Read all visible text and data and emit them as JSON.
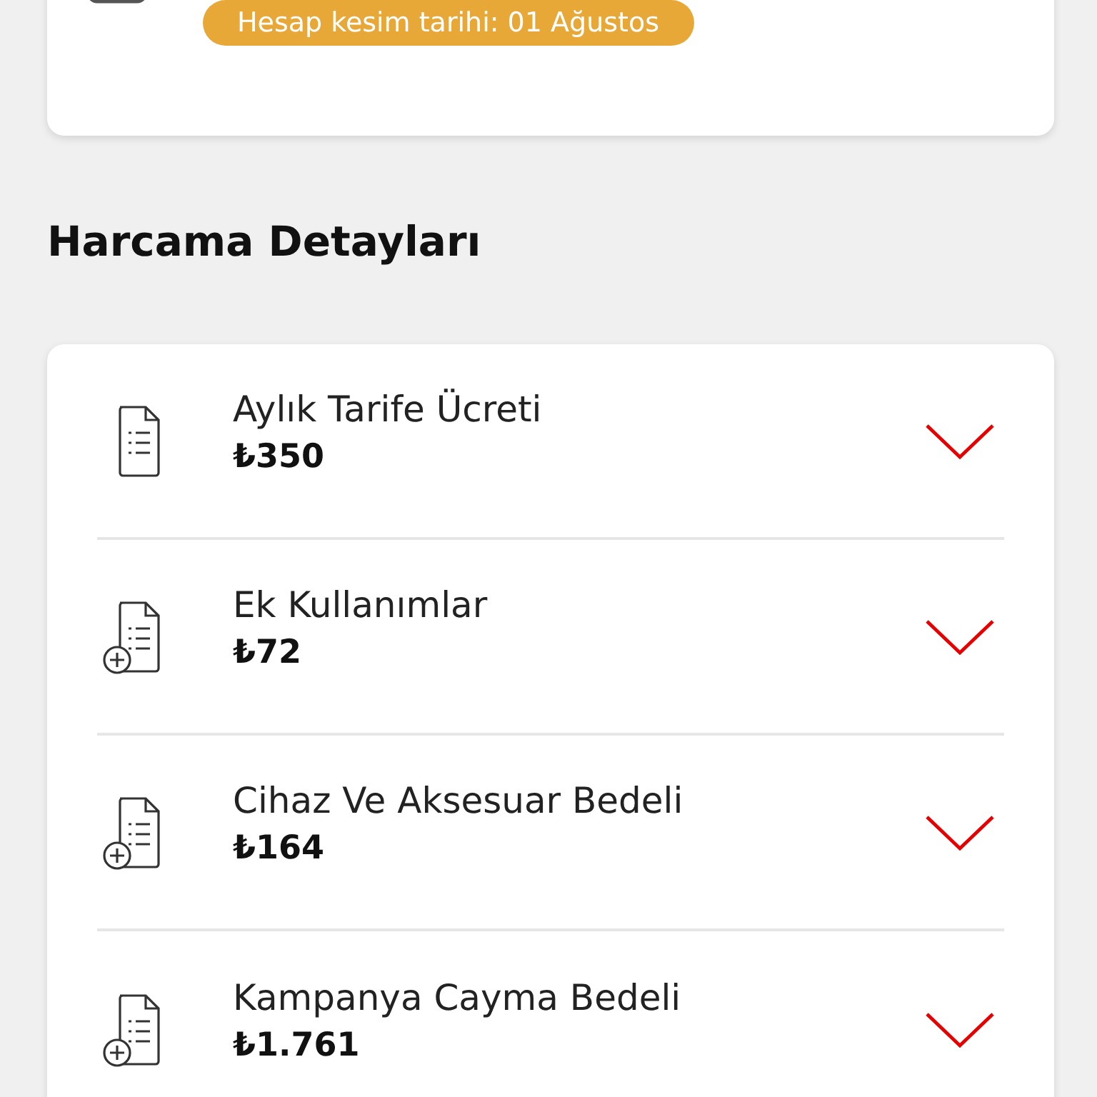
{
  "summary_card": {
    "due_badge": "Hesap kesim tarihi: 01 Ağustos"
  },
  "section_title": "Harcama Detayları",
  "items": [
    {
      "kind": "plain",
      "title": "Aylık Tarife Ücreti",
      "amount": "₺350",
      "expanded": false
    },
    {
      "kind": "plus",
      "title": "Ek Kullanımlar",
      "amount": "₺72",
      "expanded": false
    },
    {
      "kind": "plus",
      "title": "Cihaz Ve Aksesuar Bedeli",
      "amount": "₺164",
      "expanded": false
    },
    {
      "kind": "plus",
      "title": "Kampanya Cayma Bedeli",
      "amount": "₺1.761",
      "expanded": false
    }
  ]
}
